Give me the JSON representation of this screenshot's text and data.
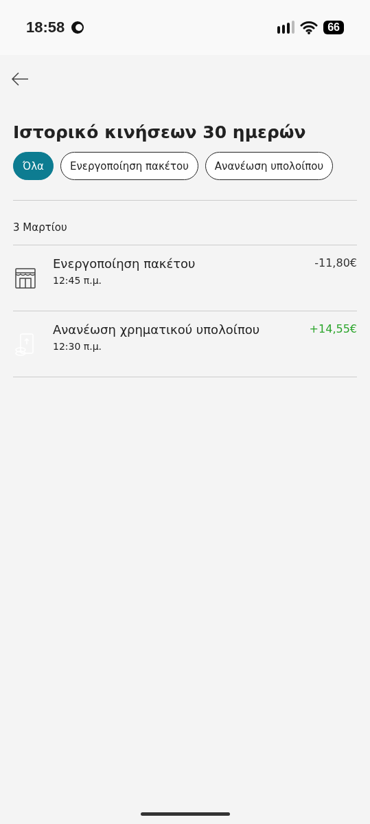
{
  "status_bar": {
    "time": "18:58",
    "battery": "66"
  },
  "title": "Ιστορικό κινήσεων 30 ημερών",
  "filters": [
    {
      "label": "Όλα",
      "selected": true
    },
    {
      "label": "Ενεργοποίηση πακέτου",
      "selected": false
    },
    {
      "label": "Ανανέωση υπολοίπου",
      "selected": false
    }
  ],
  "groups": [
    {
      "date": "3 Μαρτίου",
      "transactions": [
        {
          "kind": "shop",
          "title": "Ενεργοποίηση πακέτου",
          "time": "12:45 π.μ.",
          "amount": "-11,80€",
          "color": "#333333"
        },
        {
          "kind": "topup",
          "title": "Ανανέωση χρηματικού υπολοίπου",
          "time": "12:30 π.μ.",
          "amount": "+14,55€",
          "color": "#2ba52b"
        }
      ]
    }
  ]
}
